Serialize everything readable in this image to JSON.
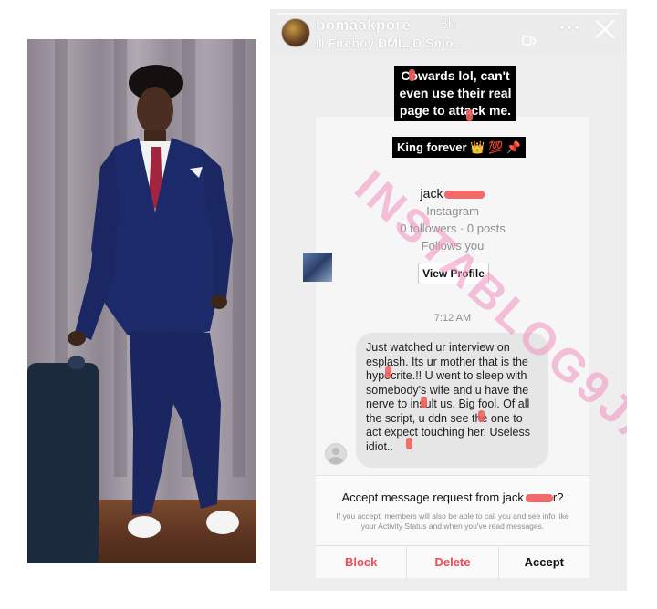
{
  "story": {
    "username": "bomaakpore",
    "time_ago": "3h",
    "music_icon": "music-bars-icon",
    "music_text": "Fireboy DML, D Smo...",
    "caption_line1": "Cowards lol, can't even use their real page to attack me.",
    "caption_line2": "King forever 👑 💯 📌"
  },
  "profile": {
    "name": "jack",
    "platform": "Instagram",
    "stats": "0 followers · 0 posts",
    "relation": "Follows you",
    "view_button": "View Profile"
  },
  "message": {
    "time": "7:12 AM",
    "text": "Just watched ur interview on esplash. Its ur mother that is the hypocrite.!! U went to sleep with somebody's wife and u have the nerve to insult us. Big fool. Of all the script, u ddn see the one to act expect touching her. Useless idiot.."
  },
  "request": {
    "title_prefix": "Accept message request from jack",
    "title_suffix": "r?",
    "info": "If you accept, members will also be able to call you and see info like your Activity Status and when you've read messages.",
    "block": "Block",
    "delete": "Delete",
    "accept": "Accept"
  },
  "watermark": "INSTABLOG9JA",
  "colors": {
    "redact": "#f26b6b",
    "danger": "#ed4956",
    "watermark": "#f08fc0"
  }
}
